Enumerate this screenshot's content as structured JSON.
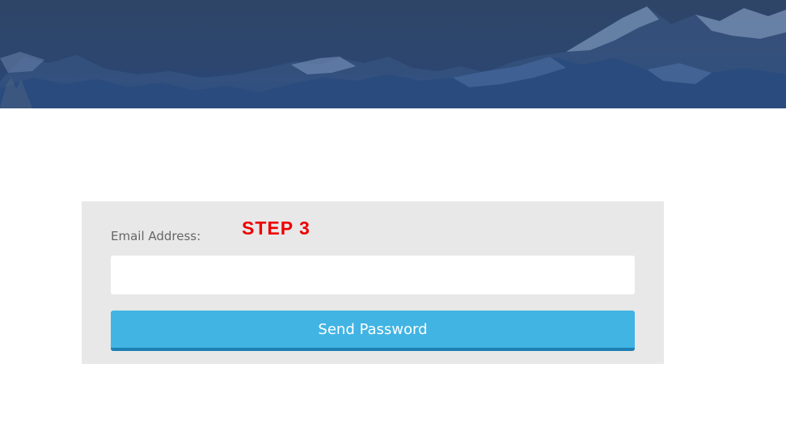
{
  "hero": {
    "image": "snowy-mountain-range-banner"
  },
  "form": {
    "email_label": "Email Address:",
    "email_value": "",
    "email_placeholder": "",
    "submit_label": "Send Password"
  },
  "annotation": {
    "step_label": "STEP 3"
  },
  "colors": {
    "hero_overlay": "#2c4670",
    "panel_background": "#e8e8e8",
    "button_background": "#41b4e4",
    "button_shadow": "#1e7fb3",
    "annotation": "#ee0000"
  }
}
